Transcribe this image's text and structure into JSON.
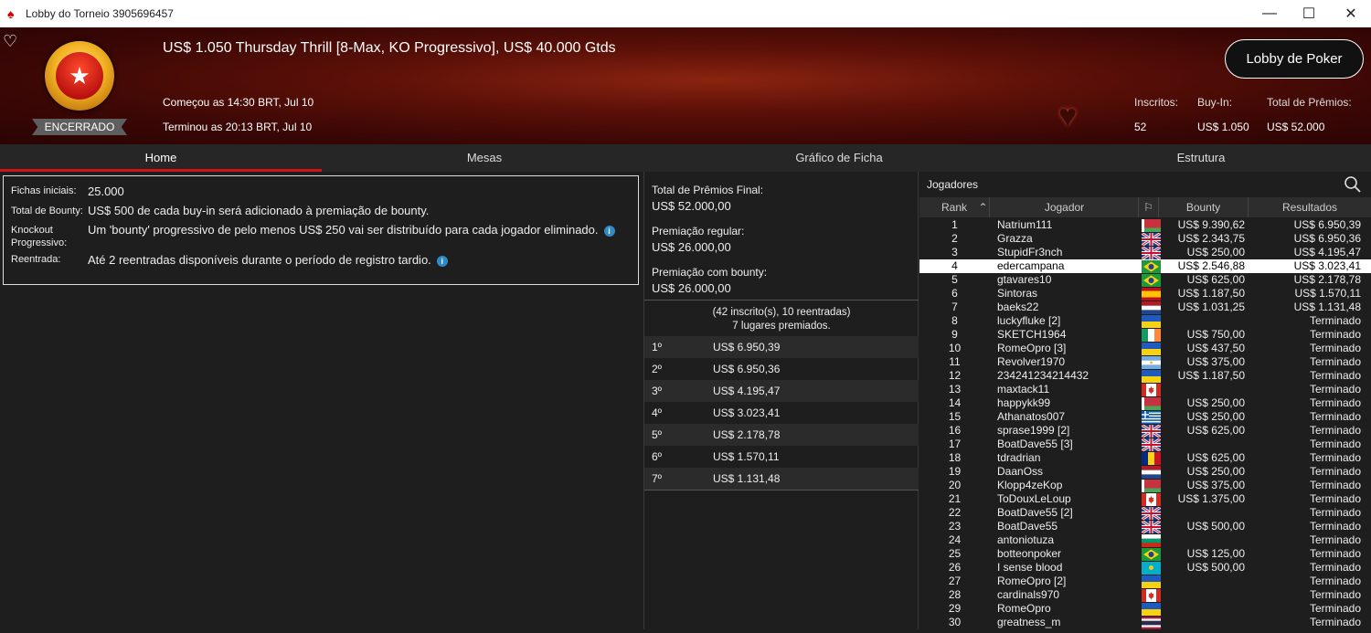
{
  "window": {
    "title": "Lobby do Torneio 3905696457"
  },
  "header": {
    "tournament_name": "US$ 1.050 Thursday Thrill [8-Max, KO Progressivo], US$ 40.000 Gtds",
    "status": "ENCERRADO",
    "started": "Começou as 14:30 BRT, Jul 10",
    "ended": "Terminou as 20:13 BRT, Jul 10",
    "lobby_button": "Lobby de Poker",
    "stats": [
      {
        "label": "Inscritos:",
        "value": "52"
      },
      {
        "label": "Buy-In:",
        "value": "US$ 1.050"
      },
      {
        "label": "Total de Prêmios:",
        "value": "US$ 52.000"
      }
    ]
  },
  "tabs": [
    {
      "label": "Home",
      "active": true
    },
    {
      "label": "Mesas",
      "active": false
    },
    {
      "label": "Gráfico de Ficha",
      "active": false
    },
    {
      "label": "Estrutura",
      "active": false
    }
  ],
  "info": [
    {
      "key": "Fichas iniciais:",
      "value": "25.000"
    },
    {
      "key": "Total de Bounty:",
      "value": "US$ 500 de cada buy-in será adicionado à premiação de bounty."
    },
    {
      "key": "Knockout Progressivo:",
      "value": "Um 'bounty' progressivo de pelo menos US$ 250 vai ser distribuído para cada jogador eliminado."
    },
    {
      "key": "Reentrada:",
      "value": "Até 2 reentradas disponíveis durante o período de registro tardio."
    }
  ],
  "prize": {
    "total_label": "Total de Prêmios Final:",
    "total_value": "US$ 52.000,00",
    "regular_label": "Premiação regular:",
    "regular_value": "US$ 26.000,00",
    "bounty_label": "Premiação com bounty:",
    "bounty_value": "US$ 26.000,00",
    "note_line1": "(42 inscrito(s), 10 reentradas)",
    "note_line2": "7 lugares premiados.",
    "places": [
      {
        "pos": "1º",
        "amount": "US$ 6.950,39"
      },
      {
        "pos": "2º",
        "amount": "US$ 6.950,36"
      },
      {
        "pos": "3º",
        "amount": "US$ 4.195,47"
      },
      {
        "pos": "4º",
        "amount": "US$ 3.023,41"
      },
      {
        "pos": "5º",
        "amount": "US$ 2.178,78"
      },
      {
        "pos": "6º",
        "amount": "US$ 1.570,11"
      },
      {
        "pos": "7º",
        "amount": "US$ 1.131,48"
      }
    ]
  },
  "players": {
    "title": "Jogadores",
    "columns": {
      "rank": "Rank",
      "player": "Jogador",
      "bounty": "Bounty",
      "results": "Resultados"
    },
    "rows": [
      {
        "rank": "1",
        "name": "Natrium111",
        "flag": "belarus",
        "bounty": "US$ 9.390,62",
        "result": "US$ 6.950,39"
      },
      {
        "rank": "2",
        "name": "Grazza",
        "flag": "uk",
        "bounty": "US$ 2.343,75",
        "result": "US$ 6.950,36"
      },
      {
        "rank": "3",
        "name": "StupidFr3nch",
        "flag": "uk",
        "bounty": "US$ 250,00",
        "result": "US$ 4.195,47"
      },
      {
        "rank": "4",
        "name": "edercampana",
        "flag": "brazil",
        "bounty": "US$ 2.546,88",
        "result": "US$ 3.023,41",
        "me": true
      },
      {
        "rank": "5",
        "name": "gtavares10",
        "flag": "brazil",
        "bounty": "US$ 625,00",
        "result": "US$ 2.178,78"
      },
      {
        "rank": "6",
        "name": "Sintoras",
        "flag": "spain",
        "bounty": "US$ 1.187,50",
        "result": "US$ 1.570,11"
      },
      {
        "rank": "7",
        "name": "baeks22",
        "flag": "netherlands",
        "bounty": "US$ 1.031,25",
        "result": "US$ 1.131,48"
      },
      {
        "rank": "8",
        "name": "luckyfluke [2]",
        "flag": "ukraine",
        "bounty": "",
        "result": "Terminado"
      },
      {
        "rank": "9",
        "name": "SKETCH1964",
        "flag": "ireland",
        "bounty": "US$ 750,00",
        "result": "Terminado"
      },
      {
        "rank": "10",
        "name": "RomeOpro [3]",
        "flag": "ukraine",
        "bounty": "US$ 437,50",
        "result": "Terminado"
      },
      {
        "rank": "11",
        "name": "Revolver1970",
        "flag": "argentina",
        "bounty": "US$ 375,00",
        "result": "Terminado"
      },
      {
        "rank": "12",
        "name": "234241234214432",
        "flag": "ukraine",
        "bounty": "US$ 1.187,50",
        "result": "Terminado"
      },
      {
        "rank": "13",
        "name": "maxtack11",
        "flag": "canada",
        "bounty": "",
        "result": "Terminado"
      },
      {
        "rank": "14",
        "name": "happykk99",
        "flag": "belarus",
        "bounty": "US$ 250,00",
        "result": "Terminado"
      },
      {
        "rank": "15",
        "name": "Athanatos007",
        "flag": "greece",
        "bounty": "US$ 250,00",
        "result": "Terminado"
      },
      {
        "rank": "16",
        "name": "sprase1999 [2]",
        "flag": "uk",
        "bounty": "US$ 625,00",
        "result": "Terminado"
      },
      {
        "rank": "17",
        "name": "BoatDave55 [3]",
        "flag": "uk",
        "bounty": "",
        "result": "Terminado"
      },
      {
        "rank": "18",
        "name": "tdradrian",
        "flag": "romania",
        "bounty": "US$ 625,00",
        "result": "Terminado"
      },
      {
        "rank": "19",
        "name": "DaanOss",
        "flag": "netherlands",
        "bounty": "US$ 250,00",
        "result": "Terminado"
      },
      {
        "rank": "20",
        "name": "Klopp4zeKop",
        "flag": "belarus",
        "bounty": "US$ 375,00",
        "result": "Terminado"
      },
      {
        "rank": "21",
        "name": "ToDouxLeLoup",
        "flag": "canada",
        "bounty": "US$ 1.375,00",
        "result": "Terminado"
      },
      {
        "rank": "22",
        "name": "BoatDave55 [2]",
        "flag": "uk",
        "bounty": "",
        "result": "Terminado"
      },
      {
        "rank": "23",
        "name": "BoatDave55",
        "flag": "uk",
        "bounty": "US$ 500,00",
        "result": "Terminado"
      },
      {
        "rank": "24",
        "name": "antoniotuza",
        "flag": "bulgaria",
        "bounty": "",
        "result": "Terminado"
      },
      {
        "rank": "25",
        "name": "botteonpoker",
        "flag": "brazil",
        "bounty": "US$ 125,00",
        "result": "Terminado"
      },
      {
        "rank": "26",
        "name": "I sense blood",
        "flag": "kazakhstan",
        "bounty": "US$ 500,00",
        "result": "Terminado"
      },
      {
        "rank": "27",
        "name": "RomeOpro [2]",
        "flag": "ukraine",
        "bounty": "",
        "result": "Terminado"
      },
      {
        "rank": "28",
        "name": "cardinals970",
        "flag": "canada",
        "bounty": "",
        "result": "Terminado"
      },
      {
        "rank": "29",
        "name": "RomeOpro",
        "flag": "ukraine",
        "bounty": "",
        "result": "Terminado"
      },
      {
        "rank": "30",
        "name": "greatness_m",
        "flag": "thailand",
        "bounty": "",
        "result": "Terminado"
      }
    ]
  },
  "colors": {
    "accent": "#d0121b",
    "header_bg": "#5c1008",
    "panel_bg": "#1e1e1e",
    "info_icon": "#2f8ac6"
  }
}
